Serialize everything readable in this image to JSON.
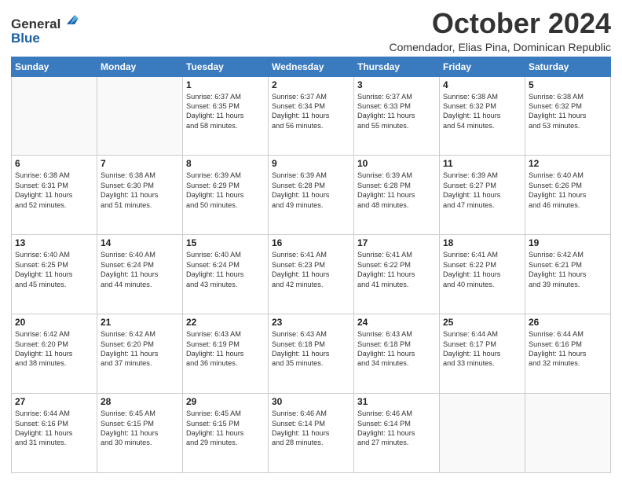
{
  "logo": {
    "general": "General",
    "blue": "Blue"
  },
  "header": {
    "month": "October 2024",
    "subtitle": "Comendador, Elias Pina, Dominican Republic"
  },
  "days_of_week": [
    "Sunday",
    "Monday",
    "Tuesday",
    "Wednesday",
    "Thursday",
    "Friday",
    "Saturday"
  ],
  "weeks": [
    [
      {
        "day": "",
        "text": ""
      },
      {
        "day": "",
        "text": ""
      },
      {
        "day": "1",
        "text": "Sunrise: 6:37 AM\nSunset: 6:35 PM\nDaylight: 11 hours and 58 minutes."
      },
      {
        "day": "2",
        "text": "Sunrise: 6:37 AM\nSunset: 6:34 PM\nDaylight: 11 hours and 56 minutes."
      },
      {
        "day": "3",
        "text": "Sunrise: 6:37 AM\nSunset: 6:33 PM\nDaylight: 11 hours and 55 minutes."
      },
      {
        "day": "4",
        "text": "Sunrise: 6:38 AM\nSunset: 6:32 PM\nDaylight: 11 hours and 54 minutes."
      },
      {
        "day": "5",
        "text": "Sunrise: 6:38 AM\nSunset: 6:32 PM\nDaylight: 11 hours and 53 minutes."
      }
    ],
    [
      {
        "day": "6",
        "text": "Sunrise: 6:38 AM\nSunset: 6:31 PM\nDaylight: 11 hours and 52 minutes."
      },
      {
        "day": "7",
        "text": "Sunrise: 6:38 AM\nSunset: 6:30 PM\nDaylight: 11 hours and 51 minutes."
      },
      {
        "day": "8",
        "text": "Sunrise: 6:39 AM\nSunset: 6:29 PM\nDaylight: 11 hours and 50 minutes."
      },
      {
        "day": "9",
        "text": "Sunrise: 6:39 AM\nSunset: 6:28 PM\nDaylight: 11 hours and 49 minutes."
      },
      {
        "day": "10",
        "text": "Sunrise: 6:39 AM\nSunset: 6:28 PM\nDaylight: 11 hours and 48 minutes."
      },
      {
        "day": "11",
        "text": "Sunrise: 6:39 AM\nSunset: 6:27 PM\nDaylight: 11 hours and 47 minutes."
      },
      {
        "day": "12",
        "text": "Sunrise: 6:40 AM\nSunset: 6:26 PM\nDaylight: 11 hours and 46 minutes."
      }
    ],
    [
      {
        "day": "13",
        "text": "Sunrise: 6:40 AM\nSunset: 6:25 PM\nDaylight: 11 hours and 45 minutes."
      },
      {
        "day": "14",
        "text": "Sunrise: 6:40 AM\nSunset: 6:24 PM\nDaylight: 11 hours and 44 minutes."
      },
      {
        "day": "15",
        "text": "Sunrise: 6:40 AM\nSunset: 6:24 PM\nDaylight: 11 hours and 43 minutes."
      },
      {
        "day": "16",
        "text": "Sunrise: 6:41 AM\nSunset: 6:23 PM\nDaylight: 11 hours and 42 minutes."
      },
      {
        "day": "17",
        "text": "Sunrise: 6:41 AM\nSunset: 6:22 PM\nDaylight: 11 hours and 41 minutes."
      },
      {
        "day": "18",
        "text": "Sunrise: 6:41 AM\nSunset: 6:22 PM\nDaylight: 11 hours and 40 minutes."
      },
      {
        "day": "19",
        "text": "Sunrise: 6:42 AM\nSunset: 6:21 PM\nDaylight: 11 hours and 39 minutes."
      }
    ],
    [
      {
        "day": "20",
        "text": "Sunrise: 6:42 AM\nSunset: 6:20 PM\nDaylight: 11 hours and 38 minutes."
      },
      {
        "day": "21",
        "text": "Sunrise: 6:42 AM\nSunset: 6:20 PM\nDaylight: 11 hours and 37 minutes."
      },
      {
        "day": "22",
        "text": "Sunrise: 6:43 AM\nSunset: 6:19 PM\nDaylight: 11 hours and 36 minutes."
      },
      {
        "day": "23",
        "text": "Sunrise: 6:43 AM\nSunset: 6:18 PM\nDaylight: 11 hours and 35 minutes."
      },
      {
        "day": "24",
        "text": "Sunrise: 6:43 AM\nSunset: 6:18 PM\nDaylight: 11 hours and 34 minutes."
      },
      {
        "day": "25",
        "text": "Sunrise: 6:44 AM\nSunset: 6:17 PM\nDaylight: 11 hours and 33 minutes."
      },
      {
        "day": "26",
        "text": "Sunrise: 6:44 AM\nSunset: 6:16 PM\nDaylight: 11 hours and 32 minutes."
      }
    ],
    [
      {
        "day": "27",
        "text": "Sunrise: 6:44 AM\nSunset: 6:16 PM\nDaylight: 11 hours and 31 minutes."
      },
      {
        "day": "28",
        "text": "Sunrise: 6:45 AM\nSunset: 6:15 PM\nDaylight: 11 hours and 30 minutes."
      },
      {
        "day": "29",
        "text": "Sunrise: 6:45 AM\nSunset: 6:15 PM\nDaylight: 11 hours and 29 minutes."
      },
      {
        "day": "30",
        "text": "Sunrise: 6:46 AM\nSunset: 6:14 PM\nDaylight: 11 hours and 28 minutes."
      },
      {
        "day": "31",
        "text": "Sunrise: 6:46 AM\nSunset: 6:14 PM\nDaylight: 11 hours and 27 minutes."
      },
      {
        "day": "",
        "text": ""
      },
      {
        "day": "",
        "text": ""
      }
    ]
  ]
}
